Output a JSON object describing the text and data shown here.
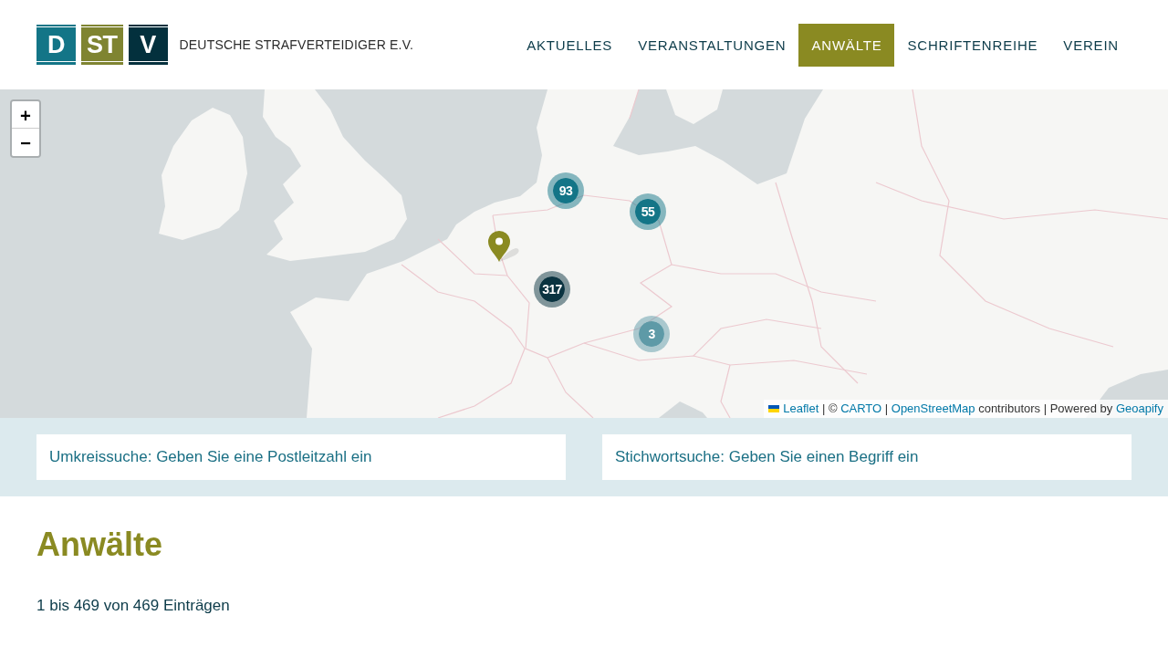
{
  "header": {
    "logo": {
      "tiles": [
        {
          "letters": "D",
          "color": "#137587"
        },
        {
          "letters": "ST",
          "color": "#7f8431"
        },
        {
          "letters": "V",
          "color": "#03303d"
        }
      ],
      "name": "DEUTSCHE STRAFVERTEIDIGER E.V."
    },
    "nav": [
      {
        "label": "AKTUELLES",
        "selected": false
      },
      {
        "label": "VERANSTALTUNGEN",
        "selected": false
      },
      {
        "label": "ANWÄLTE",
        "selected": true
      },
      {
        "label": "SCHRIFTENREIHE",
        "selected": false
      },
      {
        "label": "VEREIN",
        "selected": false
      }
    ]
  },
  "map": {
    "zoom_controls": [
      "+",
      "−"
    ],
    "markers": [
      {
        "kind": "cluster",
        "count": "93",
        "color": "#137587"
      },
      {
        "kind": "cluster",
        "count": "55",
        "color": "#137587"
      },
      {
        "kind": "pin",
        "color": "#8a8a22"
      },
      {
        "kind": "cluster",
        "count": "317",
        "color": "#0a3340"
      },
      {
        "kind": "cluster",
        "count": "3",
        "color": "#5e9aa7"
      }
    ],
    "attribution": [
      {
        "kind": "link",
        "text": "Leaflet"
      },
      {
        "kind": "text",
        "text": " | © "
      },
      {
        "kind": "link",
        "text": "CARTO"
      },
      {
        "kind": "text",
        "text": " | "
      },
      {
        "kind": "link",
        "text": "OpenStreetMap"
      },
      {
        "kind": "text",
        "text": " contributors | Powered by "
      },
      {
        "kind": "link",
        "text": "Geoapify"
      }
    ]
  },
  "search": [
    {
      "placeholder": "Umkreissuche: Geben Sie eine Postleitzahl ein"
    },
    {
      "placeholder": "Stichwortsuche: Geben Sie einen Begriff ein"
    }
  ],
  "content": {
    "title": "Anwälte",
    "count": "1 bis 469 von 469 Einträgen"
  }
}
